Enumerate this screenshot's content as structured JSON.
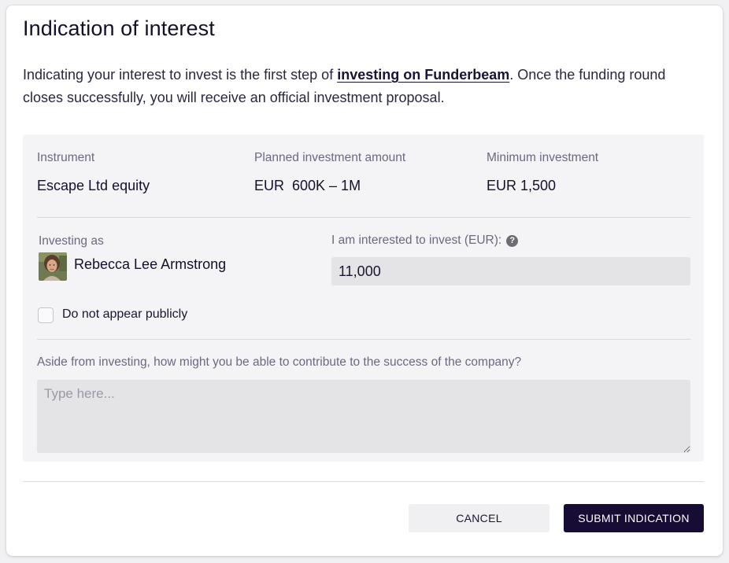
{
  "modal": {
    "title": "Indication of interest",
    "intro_before": "Indicating your interest to invest is the first step of ",
    "intro_link": "investing on Funderbeam",
    "intro_after": ". Once the funding round closes successfully, you will receive an official investment proposal."
  },
  "summary": {
    "instrument_label": "Instrument",
    "instrument_value": "Escape Ltd equity",
    "planned_label": "Planned investment amount",
    "planned_value": "EUR  600K – 1M",
    "minimum_label": "Minimum investment",
    "minimum_value": "EUR 1,500"
  },
  "investor": {
    "investing_as_label": "Investing as",
    "name": "Rebecca Lee Armstrong",
    "amount_label": "I am interested to invest (EUR):",
    "help_icon": "?",
    "amount_value": "11,000"
  },
  "privacy": {
    "checkbox_label": "Do not appear publicly",
    "checked": false
  },
  "contribution": {
    "question": "Aside from investing, how might you be able to contribute to the success of the company?",
    "placeholder": "Type here...",
    "value": ""
  },
  "actions": {
    "cancel_label": "CANCEL",
    "submit_label": "SUBMIT INDICATION"
  },
  "colors": {
    "primary": "#170c33",
    "panel_bg": "#f4f4f6",
    "input_bg": "#e4e4e7"
  }
}
